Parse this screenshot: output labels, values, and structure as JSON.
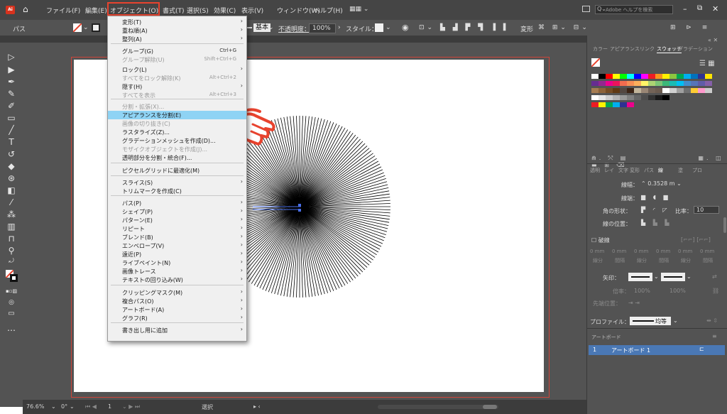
{
  "app": {
    "name": "Ai"
  },
  "menubar": {
    "items": [
      "ファイル(F)",
      "編集(E)",
      "オブジェクト(O)",
      "書式(T)",
      "選択(S)",
      "効果(C)",
      "表示(V)",
      "ウィンドウ(W)",
      "ヘルプ(H)"
    ],
    "search_placeholder": "Adobe ヘルプを検索"
  },
  "controlbar": {
    "selection_label": "パス",
    "stroke_style": "基本",
    "opacity_label": "不透明度：",
    "opacity_value": "100%",
    "style_label": "スタイル："
  },
  "object_menu": {
    "items": [
      {
        "label": "変形(T)",
        "arrow": true
      },
      {
        "label": "重ね順(A)",
        "arrow": true
      },
      {
        "label": "整列(A)",
        "arrow": true
      },
      {
        "label": "グループ(G)",
        "shortcut": "Ctrl+G"
      },
      {
        "label": "グループ解除(U)",
        "shortcut": "Shift+Ctrl+G",
        "disabled": true
      },
      {
        "label": "ロック(L)",
        "arrow": true
      },
      {
        "label": "すべてをロック解除(K)",
        "shortcut": "Alt+Ctrl+2",
        "disabled": true
      },
      {
        "label": "隠す(H)",
        "arrow": true
      },
      {
        "label": "すべてを表示",
        "shortcut": "Alt+Ctrl+3",
        "disabled": true
      },
      {
        "label": "分割・拡張(X)...",
        "disabled": true
      },
      {
        "label": "アピアランスを分割(E)",
        "highlighted": true
      },
      {
        "label": "画像の切り抜き(C)",
        "disabled": true
      },
      {
        "label": "ラスタライズ(Z)..."
      },
      {
        "label": "グラデーションメッシュを作成(D)..."
      },
      {
        "label": "モザイクオブジェクトを作成(J)...",
        "disabled": true
      },
      {
        "label": "透明部分を分割・統合(F)..."
      },
      {
        "label": "ピクセルグリッドに最適化(M)"
      },
      {
        "label": "スライス(S)",
        "arrow": true
      },
      {
        "label": "トリムマークを作成(C)"
      },
      {
        "label": "パス(P)",
        "arrow": true
      },
      {
        "label": "シェイプ(P)",
        "arrow": true
      },
      {
        "label": "パターン(E)",
        "arrow": true
      },
      {
        "label": "リピート",
        "arrow": true
      },
      {
        "label": "ブレンド(B)",
        "arrow": true
      },
      {
        "label": "エンベロープ(V)",
        "arrow": true
      },
      {
        "label": "遠近(P)",
        "arrow": true
      },
      {
        "label": "ライブペイント(N)",
        "arrow": true
      },
      {
        "label": "画像トレース",
        "arrow": true
      },
      {
        "label": "テキストの回り込み(W)",
        "arrow": true
      },
      {
        "label": "クリッピングマスク(M)",
        "arrow": true
      },
      {
        "label": "複合パス(O)",
        "arrow": true
      },
      {
        "label": "アートボード(A)",
        "arrow": true
      },
      {
        "label": "グラフ(R)",
        "arrow": true
      },
      {
        "label": "書き出し用に追加",
        "arrow": true
      }
    ]
  },
  "panels": {
    "top_tabs": [
      "カラー",
      "アピアランス",
      "リンク",
      "スウォッチ",
      "グラデーション"
    ],
    "stroke_tabs": [
      "透明",
      "レイ",
      "文字",
      "変形",
      "パス",
      "線",
      "塗",
      "プロ"
    ],
    "weight_label": "線幅：",
    "weight_value": "0.3528 m",
    "cap_label": "線端：",
    "corner_label": "角の形状：",
    "miter_label": "比率：",
    "miter_value": "10",
    "align_label": "線の位置：",
    "dashed_label": "破線",
    "dash_fields": [
      "0 mm",
      "0 mm",
      "0 mm",
      "0 mm",
      "0 mm",
      "0 mm"
    ],
    "dash_sub": [
      "線分",
      "間隔",
      "線分",
      "間隔",
      "線分",
      "間隔"
    ],
    "arrow_label": "矢印：",
    "scale_label": "倍率：",
    "scale_values": [
      "100%",
      "100%"
    ],
    "arrow_align_label": "先端位置：",
    "profile_label": "プロファイル：",
    "profile_value": "均等",
    "artboards_title": "アートボード",
    "artboard_item": {
      "num": "1",
      "name": "アートボード 1"
    }
  },
  "statusbar": {
    "zoom": "76.6%",
    "rotate": "0°",
    "artboard_num": "1",
    "tool": "選択"
  },
  "colors": {
    "accent_red": "#e8432e",
    "highlight": "#8fd3f4",
    "ui_dark": "#535353"
  }
}
